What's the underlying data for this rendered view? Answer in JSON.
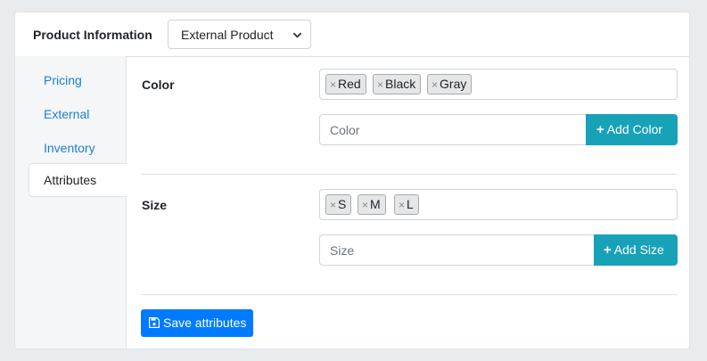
{
  "header": {
    "title": "Product Information",
    "product_type": "External Product"
  },
  "sidebar": {
    "items": [
      {
        "label": "Pricing",
        "active": false
      },
      {
        "label": "External",
        "active": false
      },
      {
        "label": "Inventory",
        "active": false
      },
      {
        "label": "Attributes",
        "active": true
      }
    ]
  },
  "attributes": {
    "color": {
      "label": "Color",
      "tags": [
        "Red",
        "Black",
        "Gray"
      ],
      "input_placeholder": "Color",
      "add_label": "Add Color"
    },
    "size": {
      "label": "Size",
      "tags": [
        "S",
        "M",
        "L"
      ],
      "input_placeholder": "Size",
      "add_label": "Add Size"
    }
  },
  "actions": {
    "save_label": "Save attributes"
  },
  "icons": {
    "tag_remove": "times-icon",
    "add": "plus-icon",
    "save": "floppy-disk-icon",
    "select": "chevron-down-icon"
  },
  "colors": {
    "link": "#1a7fd0",
    "add_button": "#17a2b8",
    "save_button": "#007bff",
    "sidebar_bg": "#f4f6f8"
  }
}
